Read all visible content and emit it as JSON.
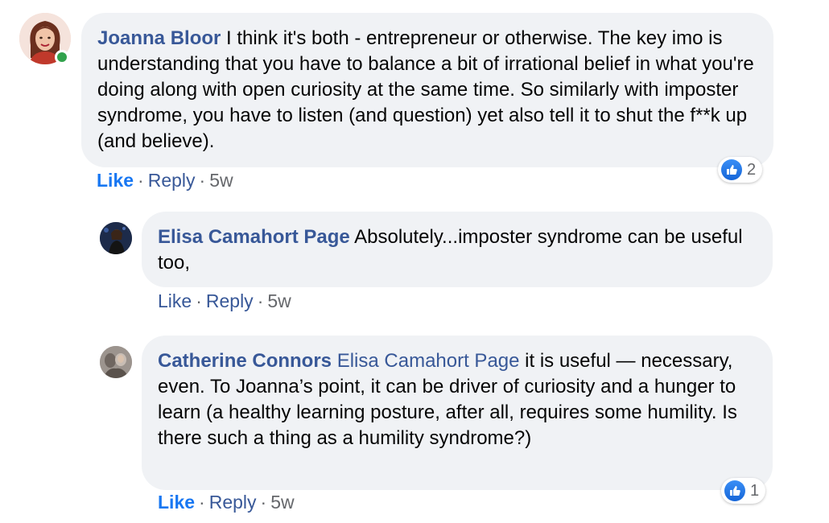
{
  "comments": [
    {
      "author": "Joanna Bloor",
      "text": "I think it's both - entrepreneur or otherwise. The key imo is understanding that you have to balance a bit of irrational belief in what you're doing along with open curiosity at the same time. So similarly with imposter syndrome, you have to listen (and question) yet also tell it to shut the f**k up (and believe).",
      "like_label": "Like",
      "reply_label": "Reply",
      "time": "5w",
      "reaction_count": "2"
    },
    {
      "author": "Elisa Camahort Page",
      "text": "Absolutely...imposter syndrome can be useful too,",
      "like_label": "Like",
      "reply_label": "Reply",
      "time": "5w"
    },
    {
      "author": "Catherine Connors",
      "mention": "Elisa Camahort Page",
      "text": "it is useful — necessary, even. To Joanna’s point, it can be driver of curiosity and a hunger to learn (a healthy learning posture, after all, requires some humility. Is there such a thing as a humility syndrome?)",
      "like_label": "Like",
      "reply_label": "Reply",
      "time": "5w",
      "reaction_count": "1"
    }
  ],
  "separator": "·",
  "colors": {
    "link": "#385898",
    "like_active": "#1877f2",
    "bubble": "#f0f2f5",
    "online": "#31a24c"
  },
  "icons": [
    "thumbs-up-icon",
    "online-status-icon"
  ]
}
